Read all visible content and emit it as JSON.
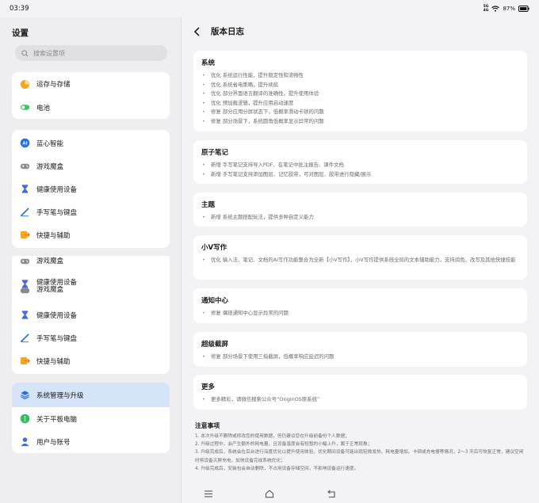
{
  "status": {
    "time": "03:39",
    "signal_top": "5G",
    "signal_bottom": "4G",
    "battery": "87%"
  },
  "settings": {
    "title": "设置",
    "search_placeholder": "搜索设置项"
  },
  "groups": [
    {
      "items": [
        {
          "label": "运存与存储",
          "icon": "pie-icon"
        },
        {
          "label": "电池",
          "icon": "battery-icon"
        }
      ]
    },
    {
      "items": [
        {
          "label": "蓝心智能",
          "icon": "ai-icon"
        },
        {
          "label": "游戏魔盒",
          "icon": "gamepad-icon"
        },
        {
          "label": "健康使用设备",
          "icon": "hourglass-icon"
        },
        {
          "label": "手写笔与键盘",
          "icon": "pen-icon"
        },
        {
          "label": "快捷与辅助",
          "icon": "shortcut-icon"
        }
      ]
    },
    {
      "items": [
        {
          "label": "游戏魔盒",
          "icon": "gamepad-icon"
        },
        {
          "label": "健康使用设备",
          "label_overlap": "游戏魔盒",
          "icon": "hourglass-icon"
        },
        {
          "label": "健康使用设备",
          "icon": "hourglass-icon"
        },
        {
          "label": "手写笔与键盘",
          "icon": "pen-icon"
        },
        {
          "label": "快捷与辅助",
          "icon": "shortcut-icon"
        }
      ]
    },
    {
      "items": [
        {
          "label": "系统管理与升级",
          "icon": "layers-icon",
          "active": true
        },
        {
          "label": "关于平板电脑",
          "icon": "info-icon"
        },
        {
          "label": "用户与账号",
          "icon": "user-icon"
        }
      ]
    }
  ],
  "page": {
    "title": "版本日志"
  },
  "changelog": [
    {
      "title": "系统",
      "items": [
        "优化 系统运行性能，提升稳定性和流畅性",
        "优化 系统省电策略，提升续航",
        "优化 部分界面语言翻译的准确性，提升使用体验",
        "优化 预加载逻辑，提升应用启动速度",
        "修复 部分应用分屏状态下，低概率滑动卡顿的问题",
        "修复 部分场景下，系统圆角低概率显示异常的问题"
      ]
    },
    {
      "title": "原子笔记",
      "items": [
        "新增 手写笔记支持导入PDF、在笔记中批注报告、课件文档",
        "新增 手写笔记支持添加图层、记忆胶带，可对图层、胶带进行隐藏/展示"
      ]
    },
    {
      "title": "主题",
      "items": [
        "新增 系统主题搭配玩法，提供多种自定义能力"
      ]
    },
    {
      "title": "小V写作",
      "items": [
        "优化 输入法、笔记、文档的AI写作功能整合为全新【小V写作】，小V写作提供系统全局的文本辅助能力，支持润色、改写及其他快捷技能"
      ]
    },
    {
      "title": "通知中心",
      "items": [
        "修复 偶现通知中心显示异常的问题"
      ]
    },
    {
      "title": "超级截屏",
      "items": [
        "修复 部分场景下使用三指截屏，低概率响应延迟的问题"
      ]
    },
    {
      "title": "更多",
      "items": [
        "更多精彩，请微信搜索公众号“OriginOS原系统”"
      ]
    }
  ],
  "notes": {
    "title": "注意事项",
    "lines": [
      "1. 本次升级不删除或修改您的使用数据，但仍建议您在升级前备份个人数据；",
      "2. 升级过程中，会产生额外的耗电量，且设备温度会有短暂的小幅上升，属于正常现象；",
      "3. 升级完成后，系统会在后台进行深度优化以提升使用体验，优化期间设备可能出现轻微发热、耗电量增加、卡顿或充电慢等情况，2～3 天后可恢复正常，建议空闲时将设备灭屏充电，加快设备完成系统优化；",
      "4. 升级完成后，安装包会自动删除，不占用设备存储空间，不影响设备运行速度。"
    ]
  },
  "colors": {
    "accent": "#2a6ee6",
    "active_bg": "#d6e4fa"
  }
}
